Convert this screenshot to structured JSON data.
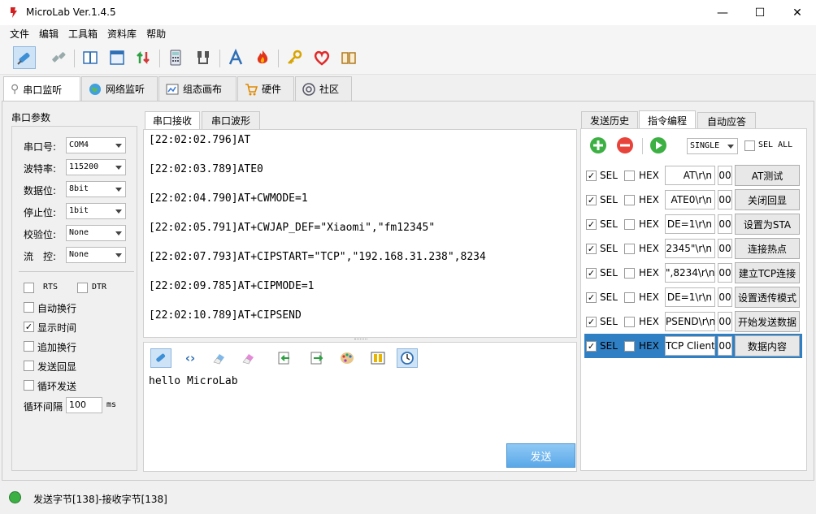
{
  "window": {
    "title": "MicroLab Ver.1.4.5",
    "minimize": "—",
    "maximize": "☐",
    "close": "✕"
  },
  "menu": [
    "文件",
    "编辑",
    "工具箱",
    "资料库",
    "帮助"
  ],
  "main_tabs": [
    {
      "label": "串口监听",
      "icon": "plug-icon"
    },
    {
      "label": "网络监听",
      "icon": "globe-icon"
    },
    {
      "label": "组态画布",
      "icon": "canvas-icon"
    },
    {
      "label": "硬件",
      "icon": "cart-icon"
    },
    {
      "label": "社区",
      "icon": "community-icon"
    }
  ],
  "serial_params": {
    "title": "串口参数",
    "fields": [
      {
        "label": "串口号:",
        "value": "COM4"
      },
      {
        "label": "波特率:",
        "value": "115200"
      },
      {
        "label": "数据位:",
        "value": "8bit"
      },
      {
        "label": "停止位:",
        "value": "1bit"
      },
      {
        "label": "校验位:",
        "value": "None"
      },
      {
        "label": "流　控:",
        "value": "None"
      }
    ],
    "rts": "RTS",
    "dtr": "DTR",
    "options": [
      {
        "label": "自动换行",
        "checked": false
      },
      {
        "label": "显示时间",
        "checked": true
      },
      {
        "label": "追加换行",
        "checked": false
      },
      {
        "label": "发送回显",
        "checked": false
      },
      {
        "label": "循环发送",
        "checked": false
      }
    ],
    "interval_label": "循环间隔",
    "interval_value": "100",
    "interval_unit": "ms"
  },
  "center_tabs": [
    "串口接收",
    "串口波形"
  ],
  "recv_lines": [
    "[22:02:02.796]AT",
    "[22:02:03.789]ATE0",
    "[22:02:04.790]AT+CWMODE=1",
    "[22:02:05.791]AT+CWJAP_DEF=\"Xiaomi\",\"fm12345\"",
    "[22:02:07.793]AT+CIPSTART=\"TCP\",\"192.168.31.238\",8234",
    "[22:02:09.785]AT+CIPMODE=1",
    "[22:02:10.789]AT+CIPSEND"
  ],
  "send_text": "hello MicroLab",
  "send_button": "发送",
  "right_tabs": [
    "发送历史",
    "指令编程",
    "自动应答"
  ],
  "cmd_toolbar": {
    "mode": "SINGLE",
    "sel_all": "SEL ALL"
  },
  "commands": [
    {
      "sel": "SEL",
      "hex": "HEX",
      "cmd": "AT\\r\\n",
      "delay": "00",
      "name": "AT测试"
    },
    {
      "sel": "SEL",
      "hex": "HEX",
      "cmd": "ATE0\\r\\n",
      "delay": "00",
      "name": "关闭回显"
    },
    {
      "sel": "SEL",
      "hex": "HEX",
      "cmd": "DE=1\\r\\n",
      "delay": "00",
      "name": "设置为STA"
    },
    {
      "sel": "SEL",
      "hex": "HEX",
      "cmd": "2345\"\\r\\n",
      "delay": "00",
      "name": "连接热点"
    },
    {
      "sel": "SEL",
      "hex": "HEX",
      "cmd": "\",8234\\r\\n",
      "delay": "00",
      "name": "建立TCP连接"
    },
    {
      "sel": "SEL",
      "hex": "HEX",
      "cmd": "DE=1\\r\\n",
      "delay": "00",
      "name": "设置透传模式"
    },
    {
      "sel": "SEL",
      "hex": "HEX",
      "cmd": "PSEND\\r\\n",
      "delay": "00",
      "name": "开始发送数据"
    },
    {
      "sel": "SEL",
      "hex": "HEX",
      "cmd": "TCP Client.",
      "delay": "00",
      "name": "数据内容"
    }
  ],
  "status": {
    "text": "发送字节[138]-接收字节[138]",
    "color": "#3cb043"
  },
  "colors": {
    "accent": "#2f7fc4",
    "send_button": "#5aa8e8"
  }
}
